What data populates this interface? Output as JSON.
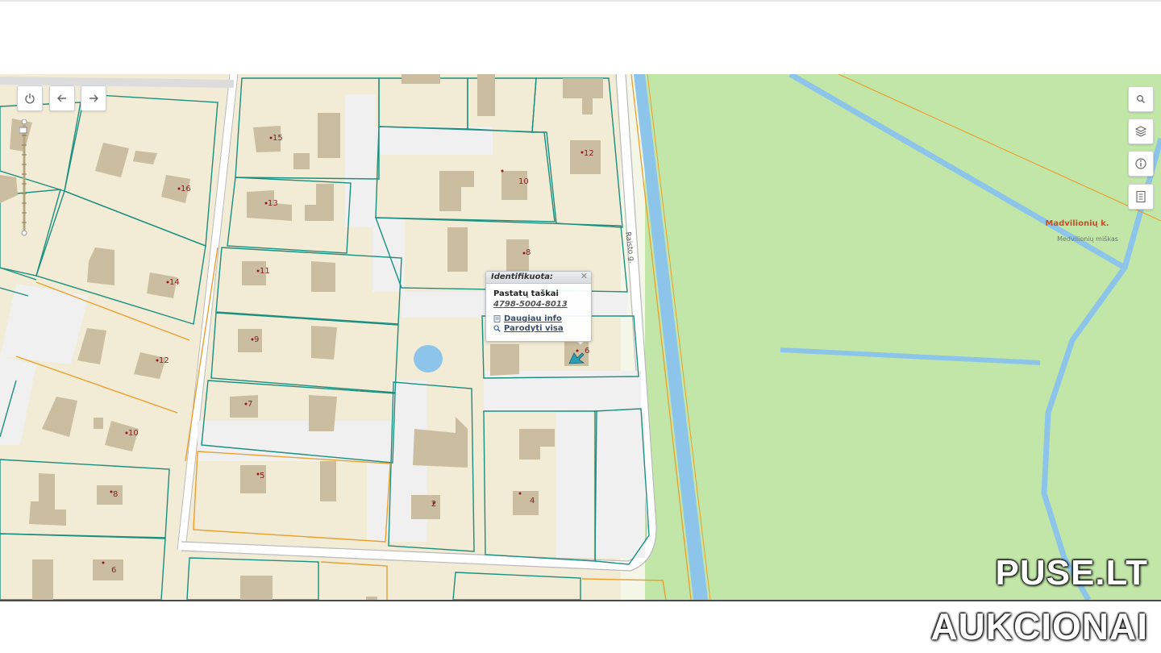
{
  "toolbar": {
    "power": {
      "icon": "power-icon"
    },
    "back": {
      "icon": "arrow-left-icon"
    },
    "forward": {
      "icon": "arrow-right-icon"
    }
  },
  "side_tools": [
    {
      "name": "search-button",
      "icon": "search-icon"
    },
    {
      "name": "layers-button",
      "icon": "layers-icon"
    },
    {
      "name": "info-button",
      "icon": "info-icon"
    },
    {
      "name": "legend-button",
      "icon": "document-icon"
    }
  ],
  "map": {
    "street_label": "Raisto g.",
    "place_name": "Madvilionių k.",
    "forest_label": "Medvilionių miškas",
    "house_numbers": [
      "15",
      "16",
      "13",
      "14",
      "11",
      "12",
      "9",
      "10",
      "7",
      "8",
      "5",
      "6",
      "12",
      "10",
      "8",
      "6",
      "4",
      "2"
    ],
    "colors": {
      "land": "#f2ebd6",
      "building": "#cbbd9f",
      "parcel_teal": "#1b8f7f",
      "parcel_orange": "#e8a030",
      "green": "#c2e6a8",
      "water": "#8cc4ea",
      "road": "#b9b9b9"
    }
  },
  "popup": {
    "header": "Identifikuota:",
    "title": "Pastatų taškai",
    "id": "4798-5004-8013",
    "more_info": "Daugiau info",
    "show_all": "Parodyti visa"
  },
  "watermark": {
    "line1": "PUSE.LT",
    "line2": "AUKCIONAI"
  }
}
